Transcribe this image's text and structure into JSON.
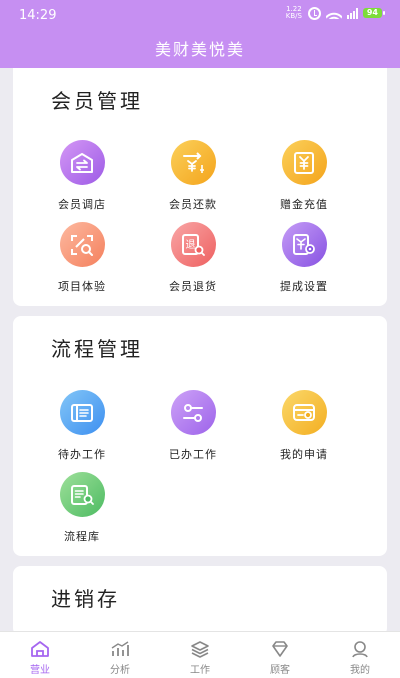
{
  "status": {
    "time": "14:29",
    "net_speed_value": "1.22",
    "net_speed_unit": "KB/S",
    "battery": "94"
  },
  "header": {
    "title": "美财美悦美"
  },
  "sections": [
    {
      "title": "会员管理",
      "items": [
        {
          "label": "会员调店",
          "icon": "shop-transfer-icon",
          "color": "#b478ef"
        },
        {
          "label": "会员还款",
          "icon": "repay-icon",
          "color": "#f6b42d"
        },
        {
          "label": "赠金充值",
          "icon": "gift-recharge-icon",
          "color": "#f6b42d"
        },
        {
          "label": "项目体验",
          "icon": "project-trial-icon",
          "color": "#f7936e"
        },
        {
          "label": "会员退货",
          "icon": "return-goods-icon",
          "color": "#f07676"
        },
        {
          "label": "提成设置",
          "icon": "commission-settings-icon",
          "color": "#9a63e8"
        }
      ]
    },
    {
      "title": "流程管理",
      "items": [
        {
          "label": "待办工作",
          "icon": "todo-work-icon",
          "color": "#4d9cf2"
        },
        {
          "label": "已办工作",
          "icon": "done-work-icon",
          "color": "#ae72ee"
        },
        {
          "label": "我的申请",
          "icon": "my-application-icon",
          "color": "#f4b328"
        },
        {
          "label": "流程库",
          "icon": "process-library-icon",
          "color": "#5dc16d"
        }
      ]
    },
    {
      "title": "进销存",
      "items": []
    }
  ],
  "bottom_nav": [
    {
      "label": "营业",
      "icon": "home-icon",
      "active": true
    },
    {
      "label": "分析",
      "icon": "analysis-icon",
      "active": false
    },
    {
      "label": "工作",
      "icon": "layers-icon",
      "active": false
    },
    {
      "label": "顾客",
      "icon": "customer-icon",
      "active": false
    },
    {
      "label": "我的",
      "icon": "profile-icon",
      "active": false
    }
  ],
  "colors": {
    "accent": "#c68ff2",
    "active_nav": "#a566f0",
    "background": "#ecebf1"
  }
}
